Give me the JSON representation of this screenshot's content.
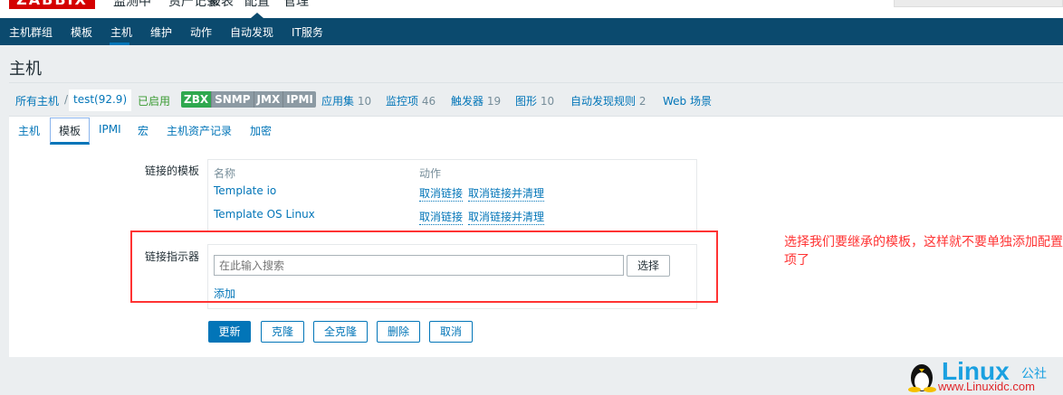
{
  "topbar": {
    "logo": "ZABBIX",
    "menu": [
      "监测中",
      "资产记录",
      "报表",
      "配置",
      "管理"
    ]
  },
  "subnav": [
    "主机群组",
    "模板",
    "主机",
    "维护",
    "动作",
    "自动发现",
    "IT服务"
  ],
  "page_title": "主机",
  "breadcrumb": {
    "all_hosts": "所有主机",
    "separator": "/",
    "host": "test(92.9)",
    "status": "已启用",
    "badges": [
      {
        "label": "ZBX",
        "color": "#2fa84f"
      },
      {
        "label": "SNMP",
        "color": "#8c9aa3"
      },
      {
        "label": "JMX",
        "color": "#8c9aa3"
      },
      {
        "label": "IPMI",
        "color": "#8c9aa3"
      }
    ],
    "links": [
      {
        "label": "应用集",
        "count": "10"
      },
      {
        "label": "监控项",
        "count": "46"
      },
      {
        "label": "触发器",
        "count": "19"
      },
      {
        "label": "图形",
        "count": "10"
      },
      {
        "label": "自动发现规则",
        "count": "2"
      },
      {
        "label": "Web 场景",
        "count": ""
      }
    ]
  },
  "tabs": [
    "主机",
    "模板",
    "IPMI",
    "宏",
    "主机资产记录",
    "加密"
  ],
  "form": {
    "linked_label": "链接的模板",
    "col_name": "名称",
    "col_action": "动作",
    "templates": [
      {
        "name": "Template io",
        "unlink": "取消链接",
        "unlink_clear": "取消链接并清理"
      },
      {
        "name": "Template OS Linux",
        "unlink": "取消链接",
        "unlink_clear": "取消链接并清理"
      }
    ],
    "indicator_label": "链接指示器",
    "search_placeholder": "在此输入搜索",
    "select": "选择",
    "add": "添加"
  },
  "buttons": {
    "update": "更新",
    "clone": "克隆",
    "full_clone": "全克隆",
    "delete": "删除",
    "cancel": "取消"
  },
  "annotation": "选择我们要继承的模板，这样就不要单独添加配置项了",
  "watermark": {
    "brand": "Linux公社",
    "url": "www.Linuxidc.com"
  }
}
